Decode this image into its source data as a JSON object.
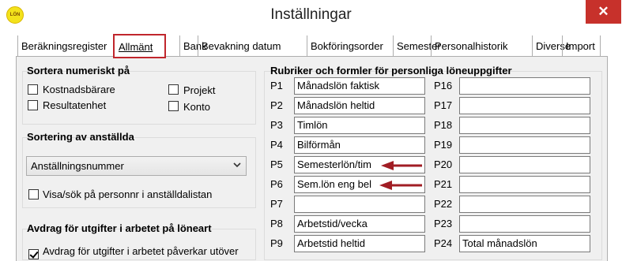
{
  "window": {
    "title": "Inställningar",
    "app_icon_text": "LÖN",
    "close_glyph": "✕"
  },
  "tabs": [
    {
      "label": "Beräkningsregister",
      "active": false
    },
    {
      "label": "Allmänt",
      "active": true
    },
    {
      "label": "Bank",
      "active": false
    },
    {
      "label": "Bevakning datum",
      "active": false
    },
    {
      "label": "Bokföringsorder",
      "active": false
    },
    {
      "label": "Semester",
      "active": false
    },
    {
      "label": "Personalhistorik",
      "active": false
    },
    {
      "label": "Diverse",
      "active": false
    },
    {
      "label": "Import",
      "active": false
    }
  ],
  "sort_numeric": {
    "title": "Sortera numeriskt på",
    "options": [
      {
        "label": "Kostnadsbärare",
        "checked": false
      },
      {
        "label": "Projekt",
        "checked": false
      },
      {
        "label": "Resultatenhet",
        "checked": false
      },
      {
        "label": "Konto",
        "checked": false
      }
    ]
  },
  "sort_employees": {
    "title": "Sortering av anställda",
    "selected": "Anställningsnummer",
    "show_pnr_label": "Visa/sök på personnr i anställdalistan",
    "show_pnr_checked": false
  },
  "deduction": {
    "title": "Avdrag för utgifter i arbetet på löneart",
    "checkbox_label": "Avdrag för utgifter i arbetet påverkar utöver",
    "checked": true
  },
  "rubriker": {
    "title": "Rubriker och formler för personliga löneuppgifter",
    "left": [
      {
        "label": "P1",
        "value": "Månadslön faktisk"
      },
      {
        "label": "P2",
        "value": "Månadslön heltid"
      },
      {
        "label": "P3",
        "value": "Timlön"
      },
      {
        "label": "P4",
        "value": "Bilförmån"
      },
      {
        "label": "P5",
        "value": "Semesterlön/tim"
      },
      {
        "label": "P6",
        "value": "Sem.lön eng bel"
      },
      {
        "label": "P7",
        "value": ""
      },
      {
        "label": "P8",
        "value": "Arbetstid/vecka"
      },
      {
        "label": "P9",
        "value": "Arbetstid heltid"
      }
    ],
    "right": [
      {
        "label": "P16",
        "value": ""
      },
      {
        "label": "P17",
        "value": ""
      },
      {
        "label": "P18",
        "value": ""
      },
      {
        "label": "P19",
        "value": ""
      },
      {
        "label": "P20",
        "value": ""
      },
      {
        "label": "P21",
        "value": ""
      },
      {
        "label": "P22",
        "value": ""
      },
      {
        "label": "P23",
        "value": ""
      },
      {
        "label": "P24",
        "value": "Total månadslön"
      }
    ]
  },
  "colors": {
    "close": "#c7312b",
    "highlight": "#c0262c",
    "arrow": "#a11d24"
  }
}
